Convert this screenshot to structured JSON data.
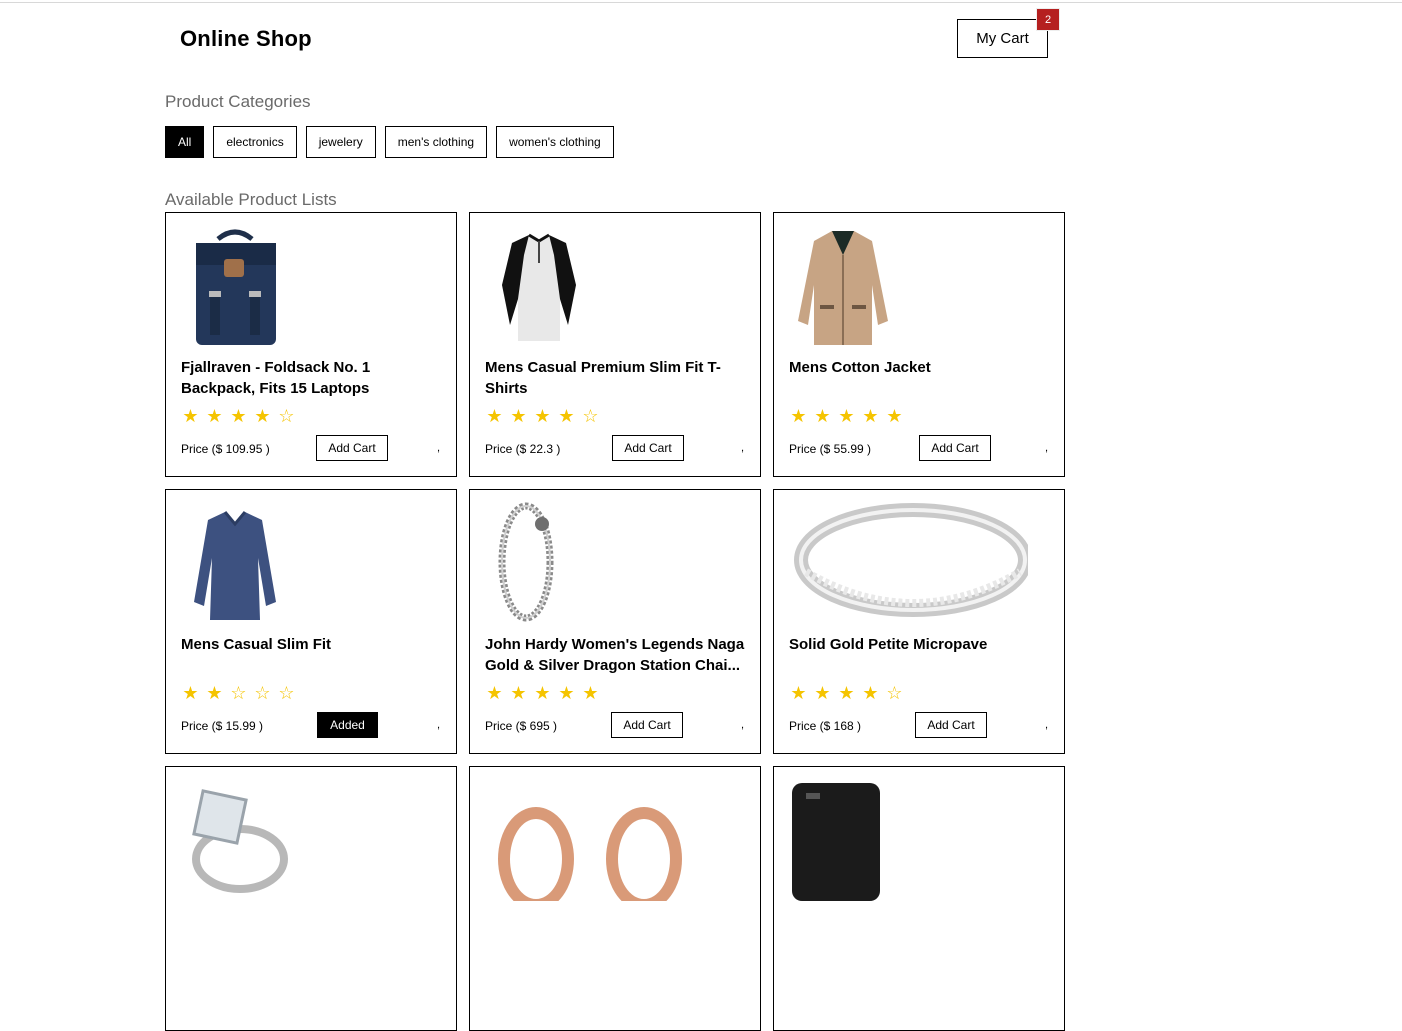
{
  "header": {
    "brand": "Online Shop",
    "cart_label": "My Cart",
    "cart_count": "2"
  },
  "categories": {
    "title": "Product Categories",
    "items": [
      "All",
      "electronics",
      "jewelery",
      "men's clothing",
      "women's clothing"
    ],
    "selected": "All"
  },
  "products": {
    "title": "Available Product Lists",
    "items": [
      {
        "title": "Fjallraven - Foldsack No. 1 Backpack, Fits 15 Laptops",
        "rating": 4,
        "price": "Price ($ 109.95 )",
        "button": "Add Cart",
        "added": false,
        "suffix": ",",
        "icon": "backpack-image"
      },
      {
        "title": "Mens Casual Premium Slim Fit T-Shirts",
        "rating": 4,
        "price": "Price ($ 22.3 )",
        "button": "Add Cart",
        "added": false,
        "suffix": ",",
        "icon": "tshirt-image"
      },
      {
        "title": "Mens Cotton Jacket",
        "rating": 5,
        "price": "Price ($ 55.99 )",
        "button": "Add Cart",
        "added": false,
        "suffix": ",",
        "icon": "jacket-image"
      },
      {
        "title": "Mens Casual Slim Fit",
        "rating": 2,
        "price": "Price ($ 15.99 )",
        "button": "Added",
        "added": true,
        "suffix": ",",
        "icon": "longsleeve-image"
      },
      {
        "title": "John Hardy Women's Legends Naga Gold & Silver Dragon Station Chai...",
        "rating": 5,
        "price": "Price ($ 695 )",
        "button": "Add Cart",
        "added": false,
        "suffix": ",",
        "icon": "bracelet-image"
      },
      {
        "title": "Solid Gold Petite Micropave",
        "rating": 4,
        "price": "Price ($ 168 )",
        "button": "Add Cart",
        "added": false,
        "suffix": ",",
        "icon": "ring-image"
      },
      {
        "title": "",
        "rating": 0,
        "price": "",
        "button": "",
        "added": false,
        "suffix": "",
        "icon": "diamond-ring-image"
      },
      {
        "title": "",
        "rating": 0,
        "price": "",
        "button": "",
        "added": false,
        "suffix": "",
        "icon": "rose-gold-plugs-image"
      },
      {
        "title": "",
        "rating": 0,
        "price": "",
        "button": "",
        "added": false,
        "suffix": "",
        "icon": "hard-drive-image"
      }
    ]
  },
  "colors": {
    "accent": "#000000",
    "badge": "#b52020",
    "star": "#f5c400",
    "muted": "#6a6a6a"
  }
}
